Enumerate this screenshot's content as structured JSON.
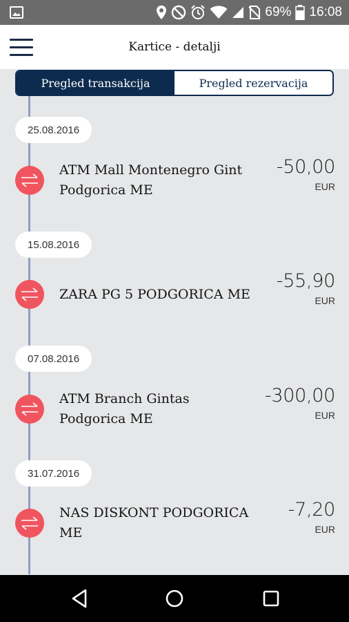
{
  "status_bar": {
    "battery": "69%",
    "time": "16:08",
    "icons": [
      "image-icon",
      "location-icon",
      "no-disturb-icon",
      "alarm-icon",
      "wifi-icon",
      "signal-icon",
      "no-sim-icon",
      "battery-icon"
    ]
  },
  "app_bar": {
    "title": "Kartice - detalji",
    "menu_icon": "hamburger-menu-icon"
  },
  "tabs": [
    {
      "label": "Pregled transakcija",
      "active": true
    },
    {
      "label": "Pregled rezervacija",
      "active": false
    }
  ],
  "colors": {
    "primary": "#0d2b4e",
    "transaction_icon": "#f0555f",
    "timeline": "#8f9dc2",
    "background": "#e6e7e9"
  },
  "transactions": [
    {
      "date": "25.08.2016",
      "merchant": "ATM Mall Montenegro Gint Podgorica ME",
      "amount": "-50,00",
      "currency": "EUR"
    },
    {
      "date": "15.08.2016",
      "merchant": "ZARA PG 5 PODGORICA ME",
      "amount": "-55,90",
      "currency": "EUR"
    },
    {
      "date": "07.08.2016",
      "merchant": "ATM Branch Gintas Podgorica ME",
      "amount": "-300,00",
      "currency": "EUR"
    },
    {
      "date": "31.07.2016",
      "merchant": "NAS DISKONT PODGORICA ME",
      "amount": "-7,20",
      "currency": "EUR"
    }
  ],
  "nav_bar": {
    "buttons": [
      "back-icon",
      "home-icon",
      "recents-icon"
    ]
  }
}
